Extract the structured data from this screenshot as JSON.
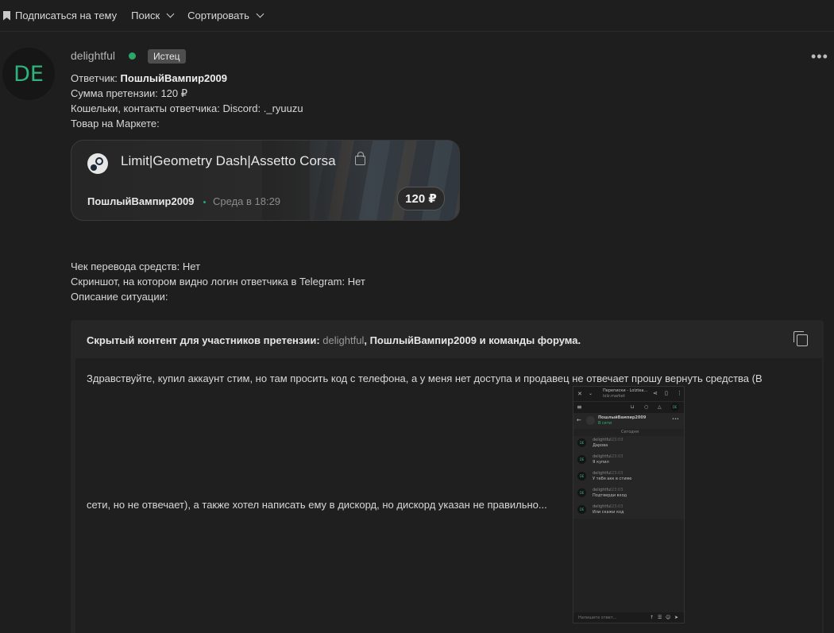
{
  "toolbar": {
    "subscribe_label": "Подписаться на тему",
    "search_label": "Поиск",
    "sort_label": "Сортировать"
  },
  "post": {
    "avatar_initials": "DE",
    "author": "delightful",
    "role_badge": "Истец",
    "more_icon": "ellipsis-icon",
    "fields": {
      "respondent_label": "Ответчик: ",
      "respondent_value": "ПошлыйВампир2009",
      "amount": "Сумма претензии: 120 ₽",
      "contacts": "Кошельки, контакты ответчика: Discord: ._ryuuzu",
      "market_label": "Товар на Маркете:",
      "receipt": "Чек перевода средств: Нет",
      "telegram_screenshot": "Скриншот, на котором видно логин ответчика в Telegram: Нет",
      "description_label": "Описание ситуации:"
    },
    "product_card": {
      "platform_icon": "steam-icon",
      "title": "Limit|Geometry Dash|Assetto Corsa",
      "seller": "ПошлыйВампир2009",
      "date": "Среда в 18:29",
      "price": "120 ₽"
    },
    "hidden_content": {
      "header_prefix": "Скрытый контент для участников претензии: ",
      "header_user": "delightful",
      "header_sep": ", ",
      "header_rest": "ПошлыйВампир2009 и команды форума.",
      "text_line1": "Здравствуйте, купил аккаунт стим, но там просить код с телефона, а у меня нет доступа и продавец не отвечает прошу вернуть средства (В",
      "text_line2": "сети, но не отвечает), а также хотел написать ему в дискорд, но дискорд указан не правильно...",
      "screenshot": {
        "window_title": "Переписки - Lolztea...",
        "window_sub": "lolz.market",
        "chat_name": "ПошлыйВампир2009",
        "chat_status": "В сети",
        "day_label": "Сегодня",
        "messages": [
          {
            "author": "delightful",
            "time": "23:03",
            "text": "Дарова"
          },
          {
            "author": "delightful",
            "time": "23:03",
            "text": "Я купил"
          },
          {
            "author": "delightful",
            "time": "23:03",
            "text": "У тебя акк в стиме"
          },
          {
            "author": "delightful",
            "time": "23:03",
            "text": "Подтверди вход"
          },
          {
            "author": "delightful",
            "time": "23:03",
            "text": "Или скажи код"
          }
        ],
        "input_placeholder": "Напишите ответ..."
      }
    }
  },
  "colors": {
    "background": "#1e1e1e",
    "accent_green": "#2fb37b",
    "online_dot": "#2aa86a",
    "badge_bg": "#4e4e4e"
  }
}
